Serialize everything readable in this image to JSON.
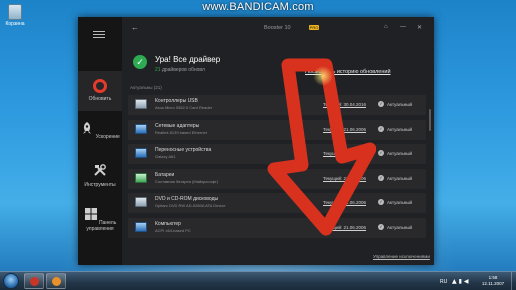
{
  "watermark": "www.BANDICAM.com",
  "desktop": {
    "icon_label": "Корзина"
  },
  "app": {
    "name": "Booster 10",
    "pro_badge": "PRO",
    "window_controls": [
      "⌂",
      "—",
      "✕"
    ],
    "sidebar": {
      "items": [
        {
          "label": "Обновить",
          "icon": "refresh-icon",
          "active": true
        },
        {
          "label": "Ускорение",
          "icon": "rocket-icon",
          "active": false
        },
        {
          "label": "Инструменты",
          "icon": "tools-icon",
          "active": false
        },
        {
          "label": "Панель управления",
          "icon": "windows-icon",
          "active": false
        }
      ]
    },
    "status": {
      "title": "Ура! Все драйвер",
      "count": "21",
      "subtitle": "драйверов обновл",
      "history_link": "Посмотреть историю обновлений"
    },
    "section_label": "Актуальны (21)",
    "drivers": [
      {
        "name": "Контроллеры USB",
        "sub": "Asus Micro 0582.0 Card Reader",
        "date": "Текущий: 30.04.2016",
        "status": "Актуальный",
        "icon": "usb-icon"
      },
      {
        "name": "Сетевые адаптеры",
        "sub": "Realtek 8139 based Ethernet",
        "date": "Текущий: 21.06.2006",
        "status": "Актуальный",
        "icon": "network-icon"
      },
      {
        "name": "Переносные устройства",
        "sub": "Galaxy A61",
        "date": "Текущий: 21.06.2006",
        "status": "Актуальный",
        "icon": "phone-icon"
      },
      {
        "name": "Батареи",
        "sub": "Составная батарея (Майкрософт)",
        "date": "Текущий: 21.06.2006",
        "status": "Актуальный",
        "icon": "battery-icon"
      },
      {
        "name": "DVD и CD-ROM дисководы",
        "sub": "Optiarc DVD RW AD-5280A ATA Device",
        "date": "Текущий: 21.06.2006",
        "status": "Актуальный",
        "icon": "disc-icon"
      },
      {
        "name": "Компьютер",
        "sub": "ACPI x64-based PC",
        "date": "Текущий: 21.06.2006",
        "status": "Актуальный",
        "icon": "computer-icon"
      }
    ],
    "manage_link": "Управление исключениями"
  },
  "taskbar": {
    "language": "RU",
    "time": "1:58",
    "date": "12.11.2007"
  },
  "colors": {
    "accent_red": "#e53b2c",
    "ok_green": "#2eab52",
    "pro_yellow": "#f0b51c",
    "arrow_red": "#d8321f"
  }
}
